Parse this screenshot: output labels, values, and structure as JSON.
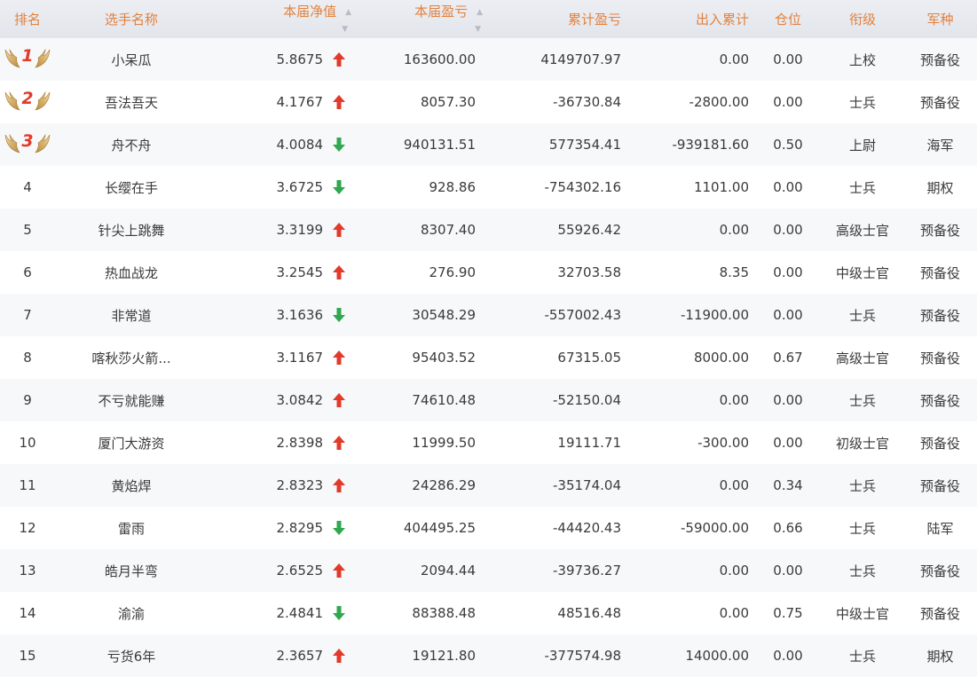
{
  "colors": {
    "header_text": "#e3813d",
    "up": "#e23a2a",
    "down": "#2fa84f",
    "medal": "#e23a2a"
  },
  "header": {
    "rank": "排名",
    "name": "选手名称",
    "nav": "本届净值",
    "pnl": "本届盈亏",
    "cum_pnl": "累计盈亏",
    "flow": "出入累计",
    "position": "仓位",
    "title": "衔级",
    "branch": "军种"
  },
  "rows": [
    {
      "rank": "1",
      "name": "小呆瓜",
      "nav": "5.8675",
      "trend": "up",
      "pnl": "163600.00",
      "cum": "4149707.97",
      "flow": "0.00",
      "pos": "0.00",
      "title": "上校",
      "branch": "预备役"
    },
    {
      "rank": "2",
      "name": "吾法吾天",
      "nav": "4.1767",
      "trend": "up",
      "pnl": "8057.30",
      "cum": "-36730.84",
      "flow": "-2800.00",
      "pos": "0.00",
      "title": "士兵",
      "branch": "预备役"
    },
    {
      "rank": "3",
      "name": "舟不舟",
      "nav": "4.0084",
      "trend": "down",
      "pnl": "940131.51",
      "cum": "577354.41",
      "flow": "-939181.60",
      "pos": "0.50",
      "title": "上尉",
      "branch": "海军"
    },
    {
      "rank": "4",
      "name": "长缨在手",
      "nav": "3.6725",
      "trend": "down",
      "pnl": "928.86",
      "cum": "-754302.16",
      "flow": "1101.00",
      "pos": "0.00",
      "title": "士兵",
      "branch": "期权"
    },
    {
      "rank": "5",
      "name": "针尖上跳舞",
      "nav": "3.3199",
      "trend": "up",
      "pnl": "8307.40",
      "cum": "55926.42",
      "flow": "0.00",
      "pos": "0.00",
      "title": "高级士官",
      "branch": "预备役"
    },
    {
      "rank": "6",
      "name": "热血战龙",
      "nav": "3.2545",
      "trend": "up",
      "pnl": "276.90",
      "cum": "32703.58",
      "flow": "8.35",
      "pos": "0.00",
      "title": "中级士官",
      "branch": "预备役"
    },
    {
      "rank": "7",
      "name": "非常道",
      "nav": "3.1636",
      "trend": "down",
      "pnl": "30548.29",
      "cum": "-557002.43",
      "flow": "-11900.00",
      "pos": "0.00",
      "title": "士兵",
      "branch": "预备役"
    },
    {
      "rank": "8",
      "name": "喀秋莎火箭...",
      "nav": "3.1167",
      "trend": "up",
      "pnl": "95403.52",
      "cum": "67315.05",
      "flow": "8000.00",
      "pos": "0.67",
      "title": "高级士官",
      "branch": "预备役"
    },
    {
      "rank": "9",
      "name": "不亏就能赚",
      "nav": "3.0842",
      "trend": "up",
      "pnl": "74610.48",
      "cum": "-52150.04",
      "flow": "0.00",
      "pos": "0.00",
      "title": "士兵",
      "branch": "预备役"
    },
    {
      "rank": "10",
      "name": "厦门大游资",
      "nav": "2.8398",
      "trend": "up",
      "pnl": "11999.50",
      "cum": "19111.71",
      "flow": "-300.00",
      "pos": "0.00",
      "title": "初级士官",
      "branch": "预备役"
    },
    {
      "rank": "11",
      "name": "黄焰焊",
      "nav": "2.8323",
      "trend": "up",
      "pnl": "24286.29",
      "cum": "-35174.04",
      "flow": "0.00",
      "pos": "0.34",
      "title": "士兵",
      "branch": "预备役"
    },
    {
      "rank": "12",
      "name": "雷雨",
      "nav": "2.8295",
      "trend": "down",
      "pnl": "404495.25",
      "cum": "-44420.43",
      "flow": "-59000.00",
      "pos": "0.66",
      "title": "士兵",
      "branch": "陆军"
    },
    {
      "rank": "13",
      "name": "皓月半弯",
      "nav": "2.6525",
      "trend": "up",
      "pnl": "2094.44",
      "cum": "-39736.27",
      "flow": "0.00",
      "pos": "0.00",
      "title": "士兵",
      "branch": "预备役"
    },
    {
      "rank": "14",
      "name": "渝渝",
      "nav": "2.4841",
      "trend": "down",
      "pnl": "88388.48",
      "cum": "48516.48",
      "flow": "0.00",
      "pos": "0.75",
      "title": "中级士官",
      "branch": "预备役"
    },
    {
      "rank": "15",
      "name": "亏货6年",
      "nav": "2.3657",
      "trend": "up",
      "pnl": "19121.80",
      "cum": "-377574.98",
      "flow": "14000.00",
      "pos": "0.00",
      "title": "士兵",
      "branch": "期权"
    }
  ]
}
